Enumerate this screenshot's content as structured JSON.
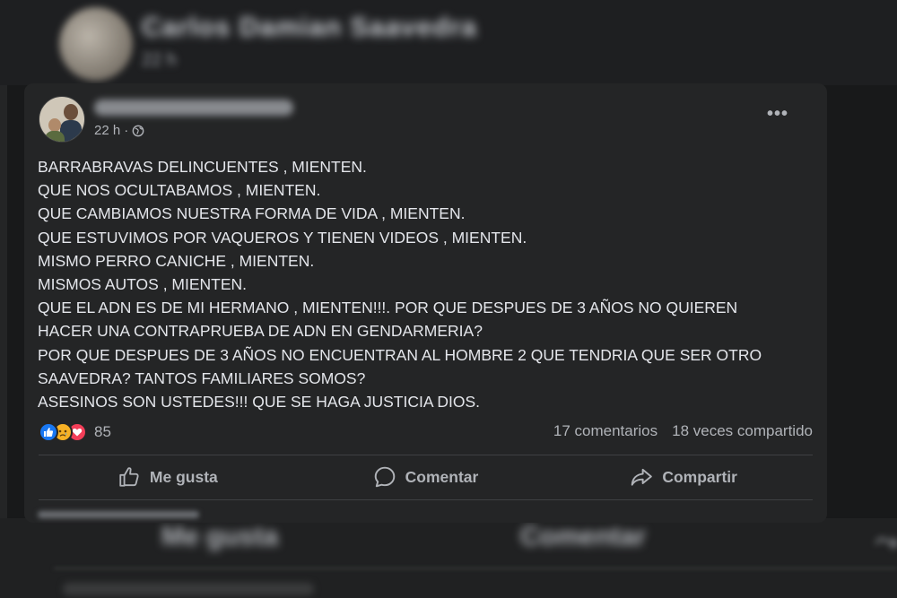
{
  "background_post": {
    "author_name": "Carlos Damian Saavedra",
    "time": "22 h",
    "actions": {
      "like_label": "Me gusta",
      "comment_label": "Comentar"
    }
  },
  "post": {
    "time": "22 h",
    "privacy_icon": "globe-icon",
    "lines": [
      "BARRABRAVAS DELINCUENTES , MIENTEN.",
      "QUE NOS OCULTABAMOS , MIENTEN.",
      "QUE CAMBIAMOS NUESTRA FORMA DE VIDA , MIENTEN.",
      "QUE ESTUVIMOS POR VAQUEROS Y TIENEN VIDEOS , MIENTEN.",
      "MISMO PERRO CANICHE , MIENTEN.",
      "MISMOS AUTOS , MIENTEN.",
      "QUE EL ADN ES DE MI HERMANO , MIENTEN!!!. POR QUE DESPUES DE 3 AÑOS NO QUIEREN",
      "HACER UNA CONTRAPRUEBA DE ADN EN GENDARMERIA?",
      "POR QUE DESPUES DE 3 AÑOS NO ENCUENTRAN AL HOMBRE 2 QUE TENDRIA QUE SER OTRO",
      "SAAVEDRA? TANTOS FAMILIARES SOMOS?",
      "ASESINOS SON USTEDES!!! QUE SE HAGA JUSTICIA DIOS."
    ],
    "reactions": {
      "types": [
        "like",
        "sad",
        "love"
      ],
      "count": "85"
    },
    "comments_count": "17 comentarios",
    "shares_count": "18 veces compartido",
    "actions": {
      "like_label": "Me gusta",
      "comment_label": "Comentar",
      "share_label": "Compartir"
    }
  },
  "colors": {
    "page_bg": "#18191a",
    "card_bg": "#242526",
    "text_primary": "#e4e6eb",
    "text_secondary": "#b0b3b8",
    "like_blue": "#1877f2",
    "sad_yellow": "#f7b125",
    "love_red": "#f33e58"
  }
}
